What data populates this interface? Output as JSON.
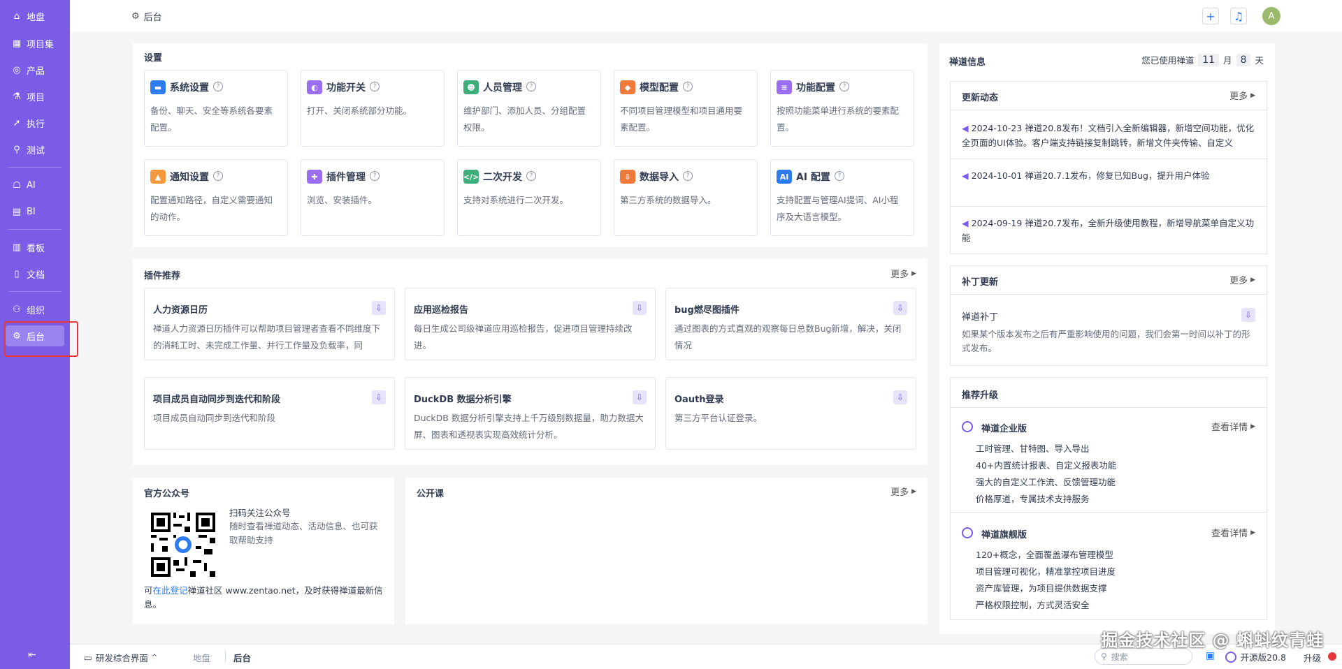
{
  "sidebar": {
    "items": [
      {
        "label": "地盘",
        "icon": "home-icon"
      },
      {
        "label": "项目集",
        "icon": "grid-icon"
      },
      {
        "label": "产品",
        "icon": "location-icon"
      },
      {
        "label": "项目",
        "icon": "flask-icon"
      },
      {
        "label": "执行",
        "icon": "rocket-icon"
      },
      {
        "label": "测试",
        "icon": "search-icon"
      },
      {
        "label": "AI",
        "icon": "robot-icon"
      },
      {
        "label": "BI",
        "icon": "chart-icon"
      },
      {
        "label": "看板",
        "icon": "kanban-icon"
      },
      {
        "label": "文档",
        "icon": "doc-icon"
      },
      {
        "label": "组织",
        "icon": "users-icon"
      },
      {
        "label": "后台",
        "icon": "gear-icon"
      }
    ],
    "collapse": "⇤"
  },
  "header": {
    "title": "后台",
    "avatar": "A"
  },
  "settings": {
    "title": "设置",
    "cards": [
      {
        "title": "系统设置",
        "desc": "备份、聊天、安全等系统各要素配置。",
        "color": "#2e7bf0",
        "glyph": "▬"
      },
      {
        "title": "功能开关",
        "desc": "打开、关闭系统部分功能。",
        "color": "#9b6df0",
        "glyph": "◐"
      },
      {
        "title": "人员管理",
        "desc": "维护部门、添加人员、分组配置权限。",
        "color": "#3fae7a",
        "glyph": "☻"
      },
      {
        "title": "模型配置",
        "desc": "不同项目管理模型和项目通用要素配置。",
        "color": "#f07a3c",
        "glyph": "◆"
      },
      {
        "title": "功能配置",
        "desc": "按照功能菜单进行系统的要素配置。",
        "color": "#9b6df0",
        "glyph": "≡"
      },
      {
        "title": "通知设置",
        "desc": "配置通知路径，自定义需要通知的动作。",
        "color": "#f59a3c",
        "glyph": "▲"
      },
      {
        "title": "插件管理",
        "desc": "浏览、安装插件。",
        "color": "#9b6df0",
        "glyph": "✚"
      },
      {
        "title": "二次开发",
        "desc": "支持对系统进行二次开发。",
        "color": "#3fae7a",
        "glyph": "</>"
      },
      {
        "title": "数据导入",
        "desc": "第三方系统的数据导入。",
        "color": "#f07a3c",
        "glyph": "⇩"
      },
      {
        "title": "AI 配置",
        "desc": "支持配置与管理AI提词、AI小程序及大语言模型。",
        "color": "#2e7bf0",
        "glyph": "AI"
      }
    ]
  },
  "plugins": {
    "title": "插件推荐",
    "more": "更多",
    "items": [
      {
        "title": "人力资源日历",
        "desc": "禅道人力资源日历插件可以帮助项目管理者查看不同维度下的消耗工时、未完成工作量、并行工作量及负载率，同"
      },
      {
        "title": "应用巡检报告",
        "desc": "每日生成公司级禅道应用巡检报告，促进项目管理持续改进。"
      },
      {
        "title": "bug燃尽图插件",
        "desc": "通过图表的方式直观的观察每日总数Bug新增，解决，关闭情况"
      },
      {
        "title": "项目成员自动同步到迭代和阶段",
        "desc": "项目成员自动同步到迭代和阶段"
      },
      {
        "title": "DuckDB 数据分析引擎",
        "desc": "DuckDB 数据分析引擎支持上千万级别数据量，助力数据大屏、图表和透视表实现高效统计分析。"
      },
      {
        "title": "Oauth登录",
        "desc": "第三方平台认证登录。"
      }
    ]
  },
  "official": {
    "title": "官方公众号",
    "scan_title": "扫码关注公众号",
    "scan_desc": "随时查看禅道动态、活动信息、也可获取帮助支持",
    "note_prefix": "可",
    "note_link": "在此登记",
    "note_suffix": "禅道社区 www.zentao.net，及时获得禅道最新信息。"
  },
  "courses": {
    "title": "公开课",
    "more": "更多"
  },
  "zentao_info": {
    "title": "禅道信息",
    "usage_prefix": "您已使用禅道",
    "months": "11",
    "month_unit": "月",
    "days": "8",
    "day_unit": "天"
  },
  "updates": {
    "title": "更新动态",
    "more": "更多",
    "items": [
      {
        "date": "2024-10-23",
        "text": "禅道20.8发布！文档引入全新编辑器，新增空间功能，优化全页面的UI体验。客户端支持链接复制跳转，新增文件夹传输、自定义"
      },
      {
        "date": "2024-10-01",
        "text": "禅道20.7.1发布，修复已知Bug，提升用户体验"
      },
      {
        "date": "2024-09-19",
        "text": "禅道20.7发布，全新升级使用教程，新增导航菜单自定义功能"
      }
    ]
  },
  "patches": {
    "title": "补丁更新",
    "more": "更多",
    "item_title": "禅道补丁",
    "item_desc": "如果某个版本发布之后有严重影响使用的问题，我们会第一时间以补丁的形式发布。"
  },
  "upgrade": {
    "title": "推荐升级",
    "editions": [
      {
        "name": "禅道企业版",
        "detail": "查看详情",
        "features": [
          "工时管理、甘特图、导入导出",
          "40+内置统计报表、自定义报表功能",
          "强大的自定义工作流、反馈管理功能",
          "价格厚道，专属技术支持服务"
        ]
      },
      {
        "name": "禅道旗舰版",
        "detail": "查看详情",
        "features": [
          "120+概念，全面覆盖瀑布管理模型",
          "项目管理可视化，精准掌控项目进度",
          "资产库管理，为项目提供数据支撑",
          "严格权限控制，方式灵活安全"
        ]
      }
    ]
  },
  "footer": {
    "ui_switch": "研发综合界面",
    "crumb1": "地盘",
    "crumb2": "后台",
    "search_placeholder": "搜索",
    "version": "开源版20.8",
    "upgrade": "升级"
  },
  "watermark": "掘金技术社区 @ 蝌蚪纹青蛙"
}
